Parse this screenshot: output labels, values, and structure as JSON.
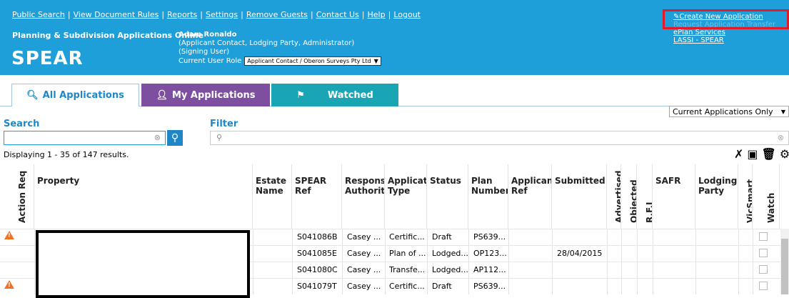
{
  "header": {
    "links": [
      "Public Search",
      "View Document Rules",
      "Reports",
      "Settings",
      "Remove Guests",
      "Contact Us",
      "Help",
      "Logout"
    ],
    "app_title": "Planning & Subdivision Applications Online",
    "user_name": "Adam Ronaldo",
    "user_roles": "(Applicant Contact, Lodging Party, Administrator)",
    "user_signing": "(Signing User)",
    "current_role_label": "Current User Role",
    "current_role_value": "Applicant Contact / Oberon Surveys Pty Ltd",
    "logo": "SPEAR",
    "right_links": {
      "create": "Create New Application",
      "hidden": "Request Application Transfer",
      "eplan": "ePlan Services",
      "lassi": "LASSI - SPEAR"
    }
  },
  "tabs": {
    "all": "All Applications",
    "my": "My Applications",
    "watched": "Watched"
  },
  "filters": {
    "scope": "Current Applications Only",
    "search_label": "Search",
    "filter_label": "Filter",
    "results": "Displaying 1 - 35 of 147 results."
  },
  "table": {
    "columns": {
      "action": "Action Req",
      "property": "Property",
      "estate": "Estate Name",
      "spear": "SPEAR Ref",
      "resp": "Responsi Authority",
      "apptype": "Applicati Type",
      "status": "Status",
      "plan": "Plan Number",
      "appref": "Applicant Ref",
      "submitted": "Submitted",
      "advertised": "Advertised",
      "objected": "Objected",
      "rfi": "R.F.I",
      "safr": "SAFR",
      "lodging": "Lodging Party",
      "vicsmart": "VicSmart",
      "watch": "Watch"
    },
    "rows": [
      {
        "spear": "S041086B",
        "resp": "Casey ...",
        "type": "Certific...",
        "status": "Draft",
        "plan": "PS639...",
        "submitted": "",
        "warn": true
      },
      {
        "spear": "S041085E",
        "resp": "Casey ...",
        "type": "Plan of ...",
        "status": "Lodged...",
        "plan": "OP123...",
        "submitted": "28/04/2015",
        "warn": false
      },
      {
        "spear": "S041080C",
        "resp": "Casey ...",
        "type": "Transfe...",
        "status": "Lodged...",
        "plan": "AP112...",
        "submitted": "",
        "warn": false
      },
      {
        "spear": "S041079T",
        "resp": "Casey ...",
        "type": "Certific...",
        "status": "Draft",
        "plan": "PS639...",
        "submitted": "",
        "warn": true
      }
    ]
  }
}
